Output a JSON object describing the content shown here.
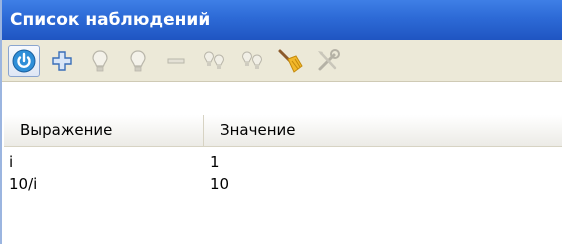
{
  "title": "Список наблюдений",
  "toolbar": {
    "buttons": [
      {
        "icon": "power-icon",
        "enabled": true
      },
      {
        "icon": "add-icon",
        "enabled": true
      },
      {
        "icon": "bulb-icon",
        "enabled": false
      },
      {
        "icon": "bulb-icon",
        "enabled": false
      },
      {
        "icon": "remove-icon",
        "enabled": false
      },
      {
        "icon": "bulbs-icon",
        "enabled": false
      },
      {
        "icon": "bulbs-icon",
        "enabled": false
      },
      {
        "icon": "broom-icon",
        "enabled": true
      },
      {
        "icon": "tools-icon",
        "enabled": false
      }
    ]
  },
  "table": {
    "headers": [
      "Выражение",
      "Значение"
    ],
    "rows": [
      [
        "i",
        "1"
      ],
      [
        "10/i",
        "10"
      ]
    ]
  },
  "colors": {
    "title_bar": "#2d6ad6",
    "toolbar_bg": "#ece9d8",
    "text": "#000000"
  }
}
